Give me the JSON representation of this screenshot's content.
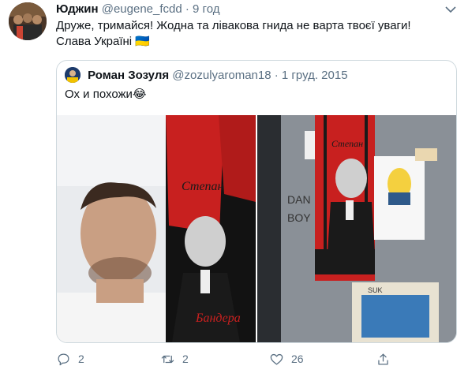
{
  "tweet": {
    "author_name": "Юджин",
    "author_handle": "@eugene_fcdd",
    "separator": "·",
    "time": "9 год",
    "text_line1": "Друже, тримайся! Жодна та лівакова гнида не варта твоєї уваги!",
    "text_line2": "Слава Україні",
    "flag": "🇺🇦"
  },
  "quoted": {
    "author_name": "Роман Зозуля",
    "author_handle": "@zozulyaroman18",
    "separator": "·",
    "date": "1 груд. 2015",
    "text": "Ох и похожи",
    "emoji": "😂",
    "photo_left": {
      "scarf_text_top": "Степан",
      "scarf_text_bottom": "Бандера"
    },
    "photo_right": {
      "scarf_text": "Степан",
      "door_text_1": "DAN",
      "door_text_2": "BOY",
      "sticker_text": "SUK"
    }
  },
  "actions": {
    "reply_count": "2",
    "retweet_count": "2",
    "like_count": "26"
  },
  "colors": {
    "muted": "#5b7083",
    "border": "#cfd9de",
    "scarf_red": "#c8201f"
  }
}
